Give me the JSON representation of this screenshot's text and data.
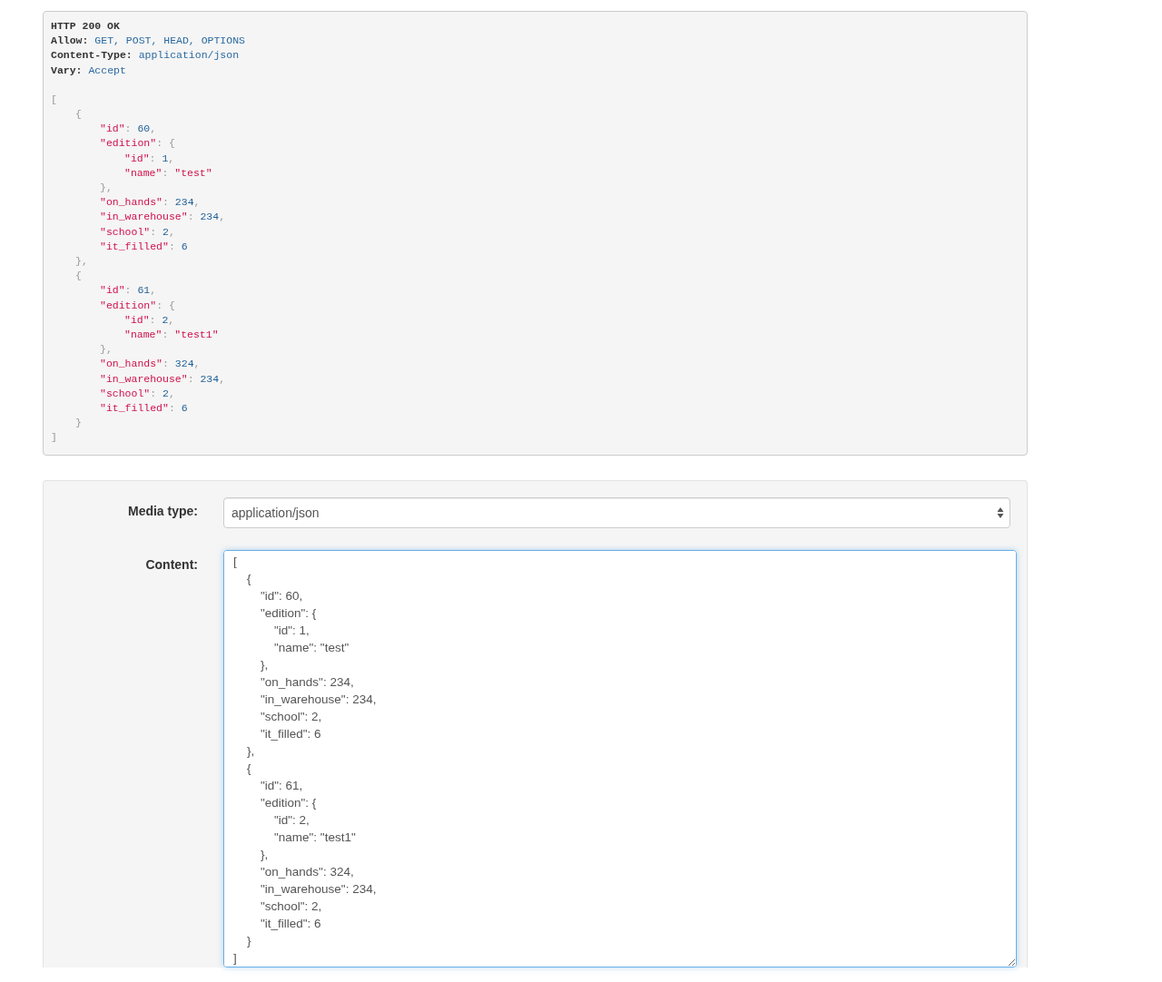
{
  "response": {
    "status": "HTTP 200 OK",
    "headers": [
      {
        "name": "Allow:",
        "value": "GET, POST, HEAD, OPTIONS"
      },
      {
        "name": "Content-Type:",
        "value": "application/json"
      },
      {
        "name": "Vary:",
        "value": "Accept"
      }
    ],
    "body": [
      {
        "tokens": [
          {
            "kind": "punct",
            "text": "["
          }
        ],
        "children": [
          {
            "tokens": [
              {
                "kind": "punct",
                "text": "{"
              }
            ],
            "children": [
              {
                "tokens": [
                  {
                    "kind": "key",
                    "text": "\"id\""
                  },
                  {
                    "kind": "punct",
                    "text": ": "
                  },
                  {
                    "kind": "number",
                    "text": "60"
                  },
                  {
                    "kind": "punct",
                    "text": ","
                  }
                ]
              },
              {
                "tokens": [
                  {
                    "kind": "key",
                    "text": "\"edition\""
                  },
                  {
                    "kind": "punct",
                    "text": ": {"
                  }
                ],
                "children": [
                  {
                    "tokens": [
                      {
                        "kind": "key",
                        "text": "\"id\""
                      },
                      {
                        "kind": "punct",
                        "text": ": "
                      },
                      {
                        "kind": "number",
                        "text": "1"
                      },
                      {
                        "kind": "punct",
                        "text": ","
                      }
                    ]
                  },
                  {
                    "tokens": [
                      {
                        "kind": "key",
                        "text": "\"name\""
                      },
                      {
                        "kind": "punct",
                        "text": ": "
                      },
                      {
                        "kind": "string",
                        "text": "\"test\""
                      }
                    ]
                  }
                ]
              },
              {
                "tokens": [
                  {
                    "kind": "punct",
                    "text": "},"
                  }
                ]
              },
              {
                "tokens": [
                  {
                    "kind": "key",
                    "text": "\"on_hands\""
                  },
                  {
                    "kind": "punct",
                    "text": ": "
                  },
                  {
                    "kind": "number",
                    "text": "234"
                  },
                  {
                    "kind": "punct",
                    "text": ","
                  }
                ]
              },
              {
                "tokens": [
                  {
                    "kind": "key",
                    "text": "\"in_warehouse\""
                  },
                  {
                    "kind": "punct",
                    "text": ": "
                  },
                  {
                    "kind": "number",
                    "text": "234"
                  },
                  {
                    "kind": "punct",
                    "text": ","
                  }
                ]
              },
              {
                "tokens": [
                  {
                    "kind": "key",
                    "text": "\"school\""
                  },
                  {
                    "kind": "punct",
                    "text": ": "
                  },
                  {
                    "kind": "number",
                    "text": "2"
                  },
                  {
                    "kind": "punct",
                    "text": ","
                  }
                ]
              },
              {
                "tokens": [
                  {
                    "kind": "key",
                    "text": "\"it_filled\""
                  },
                  {
                    "kind": "punct",
                    "text": ": "
                  },
                  {
                    "kind": "number",
                    "text": "6"
                  }
                ]
              }
            ]
          },
          {
            "tokens": [
              {
                "kind": "punct",
                "text": "},"
              }
            ]
          },
          {
            "tokens": [
              {
                "kind": "punct",
                "text": "{"
              }
            ],
            "children": [
              {
                "tokens": [
                  {
                    "kind": "key",
                    "text": "\"id\""
                  },
                  {
                    "kind": "punct",
                    "text": ": "
                  },
                  {
                    "kind": "number",
                    "text": "61"
                  },
                  {
                    "kind": "punct",
                    "text": ","
                  }
                ]
              },
              {
                "tokens": [
                  {
                    "kind": "key",
                    "text": "\"edition\""
                  },
                  {
                    "kind": "punct",
                    "text": ": {"
                  }
                ],
                "children": [
                  {
                    "tokens": [
                      {
                        "kind": "key",
                        "text": "\"id\""
                      },
                      {
                        "kind": "punct",
                        "text": ": "
                      },
                      {
                        "kind": "number",
                        "text": "2"
                      },
                      {
                        "kind": "punct",
                        "text": ","
                      }
                    ]
                  },
                  {
                    "tokens": [
                      {
                        "kind": "key",
                        "text": "\"name\""
                      },
                      {
                        "kind": "punct",
                        "text": ": "
                      },
                      {
                        "kind": "string",
                        "text": "\"test1\""
                      }
                    ]
                  }
                ]
              },
              {
                "tokens": [
                  {
                    "kind": "punct",
                    "text": "},"
                  }
                ]
              },
              {
                "tokens": [
                  {
                    "kind": "key",
                    "text": "\"on_hands\""
                  },
                  {
                    "kind": "punct",
                    "text": ": "
                  },
                  {
                    "kind": "number",
                    "text": "324"
                  },
                  {
                    "kind": "punct",
                    "text": ","
                  }
                ]
              },
              {
                "tokens": [
                  {
                    "kind": "key",
                    "text": "\"in_warehouse\""
                  },
                  {
                    "kind": "punct",
                    "text": ": "
                  },
                  {
                    "kind": "number",
                    "text": "234"
                  },
                  {
                    "kind": "punct",
                    "text": ","
                  }
                ]
              },
              {
                "tokens": [
                  {
                    "kind": "key",
                    "text": "\"school\""
                  },
                  {
                    "kind": "punct",
                    "text": ": "
                  },
                  {
                    "kind": "number",
                    "text": "2"
                  },
                  {
                    "kind": "punct",
                    "text": ","
                  }
                ]
              },
              {
                "tokens": [
                  {
                    "kind": "key",
                    "text": "\"it_filled\""
                  },
                  {
                    "kind": "punct",
                    "text": ": "
                  },
                  {
                    "kind": "number",
                    "text": "6"
                  }
                ]
              }
            ]
          },
          {
            "tokens": [
              {
                "kind": "punct",
                "text": "}"
              }
            ]
          }
        ]
      },
      {
        "tokens": [
          {
            "kind": "punct",
            "text": "]"
          }
        ]
      }
    ]
  },
  "form": {
    "fields": [
      {
        "kind": "select",
        "label": "Media type:",
        "value": "application/json"
      },
      {
        "kind": "textarea",
        "label": "Content:",
        "value": "[\n    {\n        \"id\": 60,\n        \"edition\": {\n            \"id\": 1,\n            \"name\": \"test\"\n        },\n        \"on_hands\": 234,\n        \"in_warehouse\": 234,\n        \"school\": 2,\n        \"it_filled\": 6\n    },\n    {\n        \"id\": 61,\n        \"edition\": {\n            \"id\": 2,\n            \"name\": \"test1\"\n        },\n        \"on_hands\": 324,\n        \"in_warehouse\": 234,\n        \"school\": 2,\n        \"it_filled\": 6\n    }\n]"
      }
    ]
  }
}
